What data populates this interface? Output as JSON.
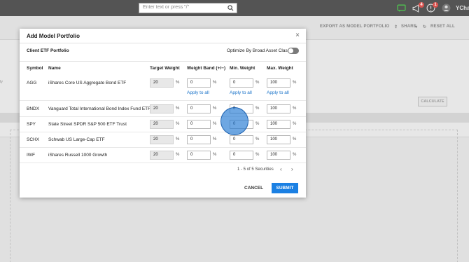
{
  "topbar": {
    "search_placeholder": "Enter text or press \"/\"",
    "badges": [
      "4",
      "1"
    ],
    "brand": "YChart"
  },
  "background": {
    "export_label": "EXPORT AS MODEL PORTFOLIO",
    "share_label": "SHARE",
    "reset_label": "RESET ALL",
    "calculate_label": "CALCULATE",
    "left_partial": "ty"
  },
  "modal": {
    "title": "Add Model Portfolio",
    "close": "×",
    "portfolio_name": "Client ETF Portfolio",
    "optimize_label": "Optimize By Broad Asset Class",
    "optimize_on": false,
    "columns": {
      "symbol": "Symbol",
      "name": "Name",
      "target": "Target Weight",
      "band": "Weight Band (+/−)",
      "min": "Min. Weight",
      "max": "Max. Weight"
    },
    "apply_all": "Apply to all",
    "pct": "%",
    "rows": [
      {
        "symbol": "AGG",
        "name": "iShares Core US Aggregate Bond ETF",
        "target": "20",
        "band": "0",
        "min": "0",
        "max": "100"
      },
      {
        "symbol": "BNDX",
        "name": "Vanguard Total International Bond Index Fund ETF",
        "target": "20",
        "band": "0",
        "min": "0",
        "max": "100"
      },
      {
        "symbol": "SPY",
        "name": "State Street SPDR S&P 500 ETF Trust",
        "target": "20",
        "band": "0",
        "min": "0",
        "max": "100"
      },
      {
        "symbol": "SCHX",
        "name": "Schwab US Large-Cap ETF",
        "target": "20",
        "band": "0",
        "min": "0",
        "max": "100"
      },
      {
        "symbol": "IWF",
        "name": "iShares Russell 1000 Growth",
        "target": "20",
        "band": "0",
        "min": "0",
        "max": "100"
      }
    ],
    "pager": "1 - 5 of 5 Securities",
    "prev": "‹",
    "next": "›",
    "cancel": "CANCEL",
    "submit": "SUBMIT"
  }
}
